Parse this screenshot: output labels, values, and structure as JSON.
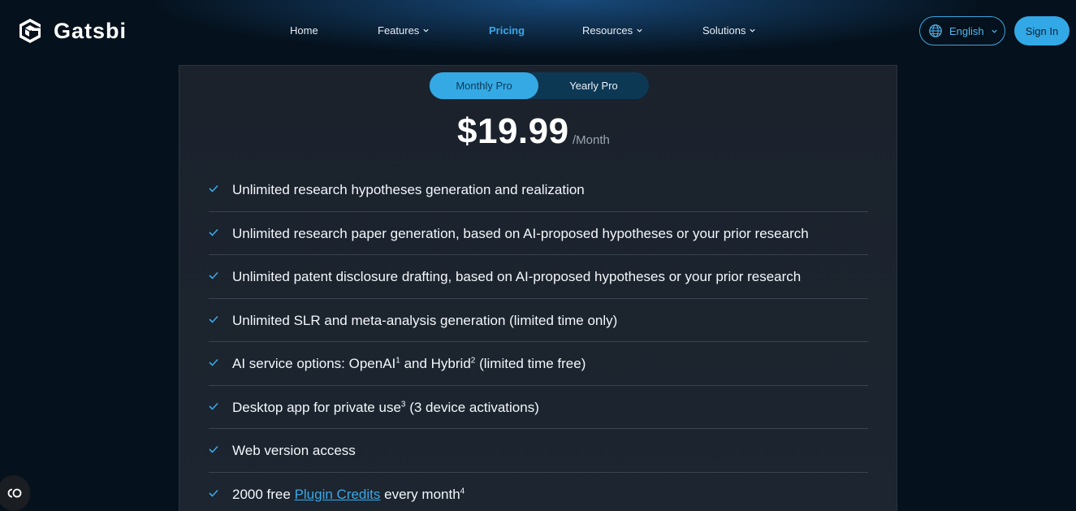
{
  "brand": {
    "name": "Gatsbi"
  },
  "nav": [
    {
      "label": "Home",
      "dropdown": false,
      "active": false
    },
    {
      "label": "Features",
      "dropdown": true,
      "active": false
    },
    {
      "label": "Pricing",
      "dropdown": false,
      "active": true
    },
    {
      "label": "Resources",
      "dropdown": true,
      "active": false
    },
    {
      "label": "Solutions",
      "dropdown": true,
      "active": false
    }
  ],
  "header_actions": {
    "language": "English",
    "signin": "Sign In"
  },
  "plan_toggle": {
    "options": [
      "Monthly Pro",
      "Yearly Pro"
    ],
    "selected": "Monthly Pro"
  },
  "pricing": {
    "price": "$19.99",
    "period": "/Month"
  },
  "features": [
    {
      "text": "Unlimited research hypotheses generation and realization"
    },
    {
      "text": "Unlimited research paper generation, based on AI-proposed hypotheses or your prior research"
    },
    {
      "text": "Unlimited patent disclosure drafting, based on AI-proposed hypotheses or your prior research"
    },
    {
      "text": "Unlimited SLR and meta-analysis generation (limited time only)"
    },
    {
      "parts": [
        "AI service options: OpenAI",
        "1",
        " and Hybrid",
        "2",
        " (limited time free)"
      ]
    },
    {
      "parts": [
        "Desktop app for private use",
        "3",
        " (3 device activations)"
      ]
    },
    {
      "text": "Web version access"
    },
    {
      "parts": [
        "2000 free ",
        "Plugin Credits",
        " every month",
        "4"
      ]
    }
  ],
  "colors": {
    "accent": "#35a9e4",
    "background": "#05111c",
    "card": "#1b222c",
    "check": "#3aa8e6"
  },
  "icons": {
    "logo": "gatsbi-logo-icon",
    "language": "globe-icon",
    "check": "check-icon",
    "cookie": "cookie-settings-icon"
  }
}
